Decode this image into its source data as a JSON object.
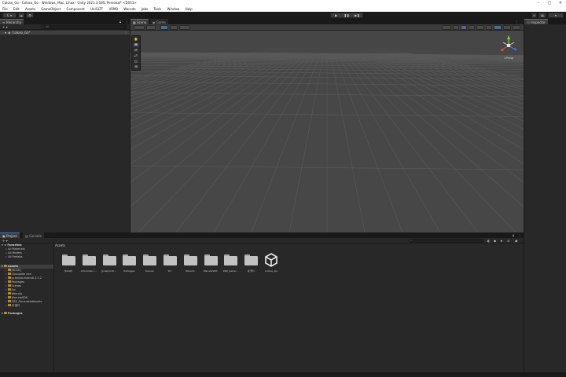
{
  "window": {
    "title": "Coloso_Go - Coloso_Go - Windows, Mac, Linux - Unity 2021.3.18f1 Personal* <DX11>",
    "controls": [
      "–",
      "□",
      "✕"
    ]
  },
  "menu": [
    "File",
    "Edit",
    "Assets",
    "GameObject",
    "Component",
    "UniGLTF",
    "VRM0",
    "Warudo",
    "Jobs",
    "Tools",
    "Window",
    "Help"
  ],
  "toolbar": {
    "account_label": "C ▾",
    "play": "▶",
    "pause": "❚❚",
    "step": "▶❚"
  },
  "hierarchy": {
    "tab": "Hierarchy",
    "search_placeholder": "All",
    "scene_name": "Coloso_Go*"
  },
  "scene": {
    "tabs": [
      "Scene",
      "Game"
    ],
    "gizmo_label": "<Persp",
    "tools": [
      "✋",
      "✥",
      "⟳",
      "⤢",
      "▢",
      "⊞"
    ]
  },
  "inspector": {
    "tab": "Inspector"
  },
  "project": {
    "tabs": [
      "Project",
      "Console"
    ],
    "add_label": "+ ▾",
    "tree": [
      {
        "label": "Favorites",
        "header": true,
        "folder": false
      },
      {
        "label": "All Materials",
        "header": false,
        "folder": false
      },
      {
        "label": "All Models",
        "header": false,
        "folder": false
      },
      {
        "label": "All Prefabs",
        "header": false,
        "folder": false
      },
      {
        "label": "Assets",
        "header": true,
        "folder": true
      },
      {
        "label": "[KCGE]",
        "header": false,
        "folder": true
      },
      {
        "label": "Chocolate rice",
        "header": false,
        "folder": true
      },
      {
        "label": "jp.keijiro.klakndi-2.1.2",
        "header": false,
        "folder": true
      },
      {
        "label": "Packages",
        "header": false,
        "folder": true
      },
      {
        "label": "Scenes",
        "header": false,
        "folder": true
      },
      {
        "label": "Src",
        "header": false,
        "folder": true
      },
      {
        "label": "Warudo",
        "header": false,
        "folder": true
      },
      {
        "label": "WarudoSDK",
        "header": false,
        "folder": true
      },
      {
        "label": "ZZZ_GeneratedAssets",
        "header": false,
        "folder": true
      },
      {
        "label": "새 폴더",
        "header": false,
        "folder": true
      },
      {
        "label": "Packages",
        "header": true,
        "folder": true
      }
    ],
    "breadcrumb": "Assets",
    "assets": [
      {
        "label": "[KCGE]",
        "kind": "folder"
      },
      {
        "label": "Chocolate r...",
        "kind": "folder"
      },
      {
        "label": "jp.keijiro.kl...",
        "kind": "folder"
      },
      {
        "label": "Packages",
        "kind": "folder"
      },
      {
        "label": "Scenes",
        "kind": "folder"
      },
      {
        "label": "Src",
        "kind": "folder"
      },
      {
        "label": "Warudo",
        "kind": "folder"
      },
      {
        "label": "WarudoSDK",
        "kind": "folder"
      },
      {
        "label": "ZZZ_Gener...",
        "kind": "folder"
      },
      {
        "label": "새 폴더",
        "kind": "folder"
      },
      {
        "label": "Coloso_Go",
        "kind": "unity-scene"
      }
    ]
  },
  "colors": {
    "panel": "#282828",
    "scene_bg": "#474747",
    "grid": "#5a5a5a",
    "accent": "#3a79bb",
    "folder": "#c2c2c2",
    "gizmo_x": "#d4503b",
    "gizmo_y": "#8ccd47",
    "gizmo_z": "#3f80d6"
  }
}
